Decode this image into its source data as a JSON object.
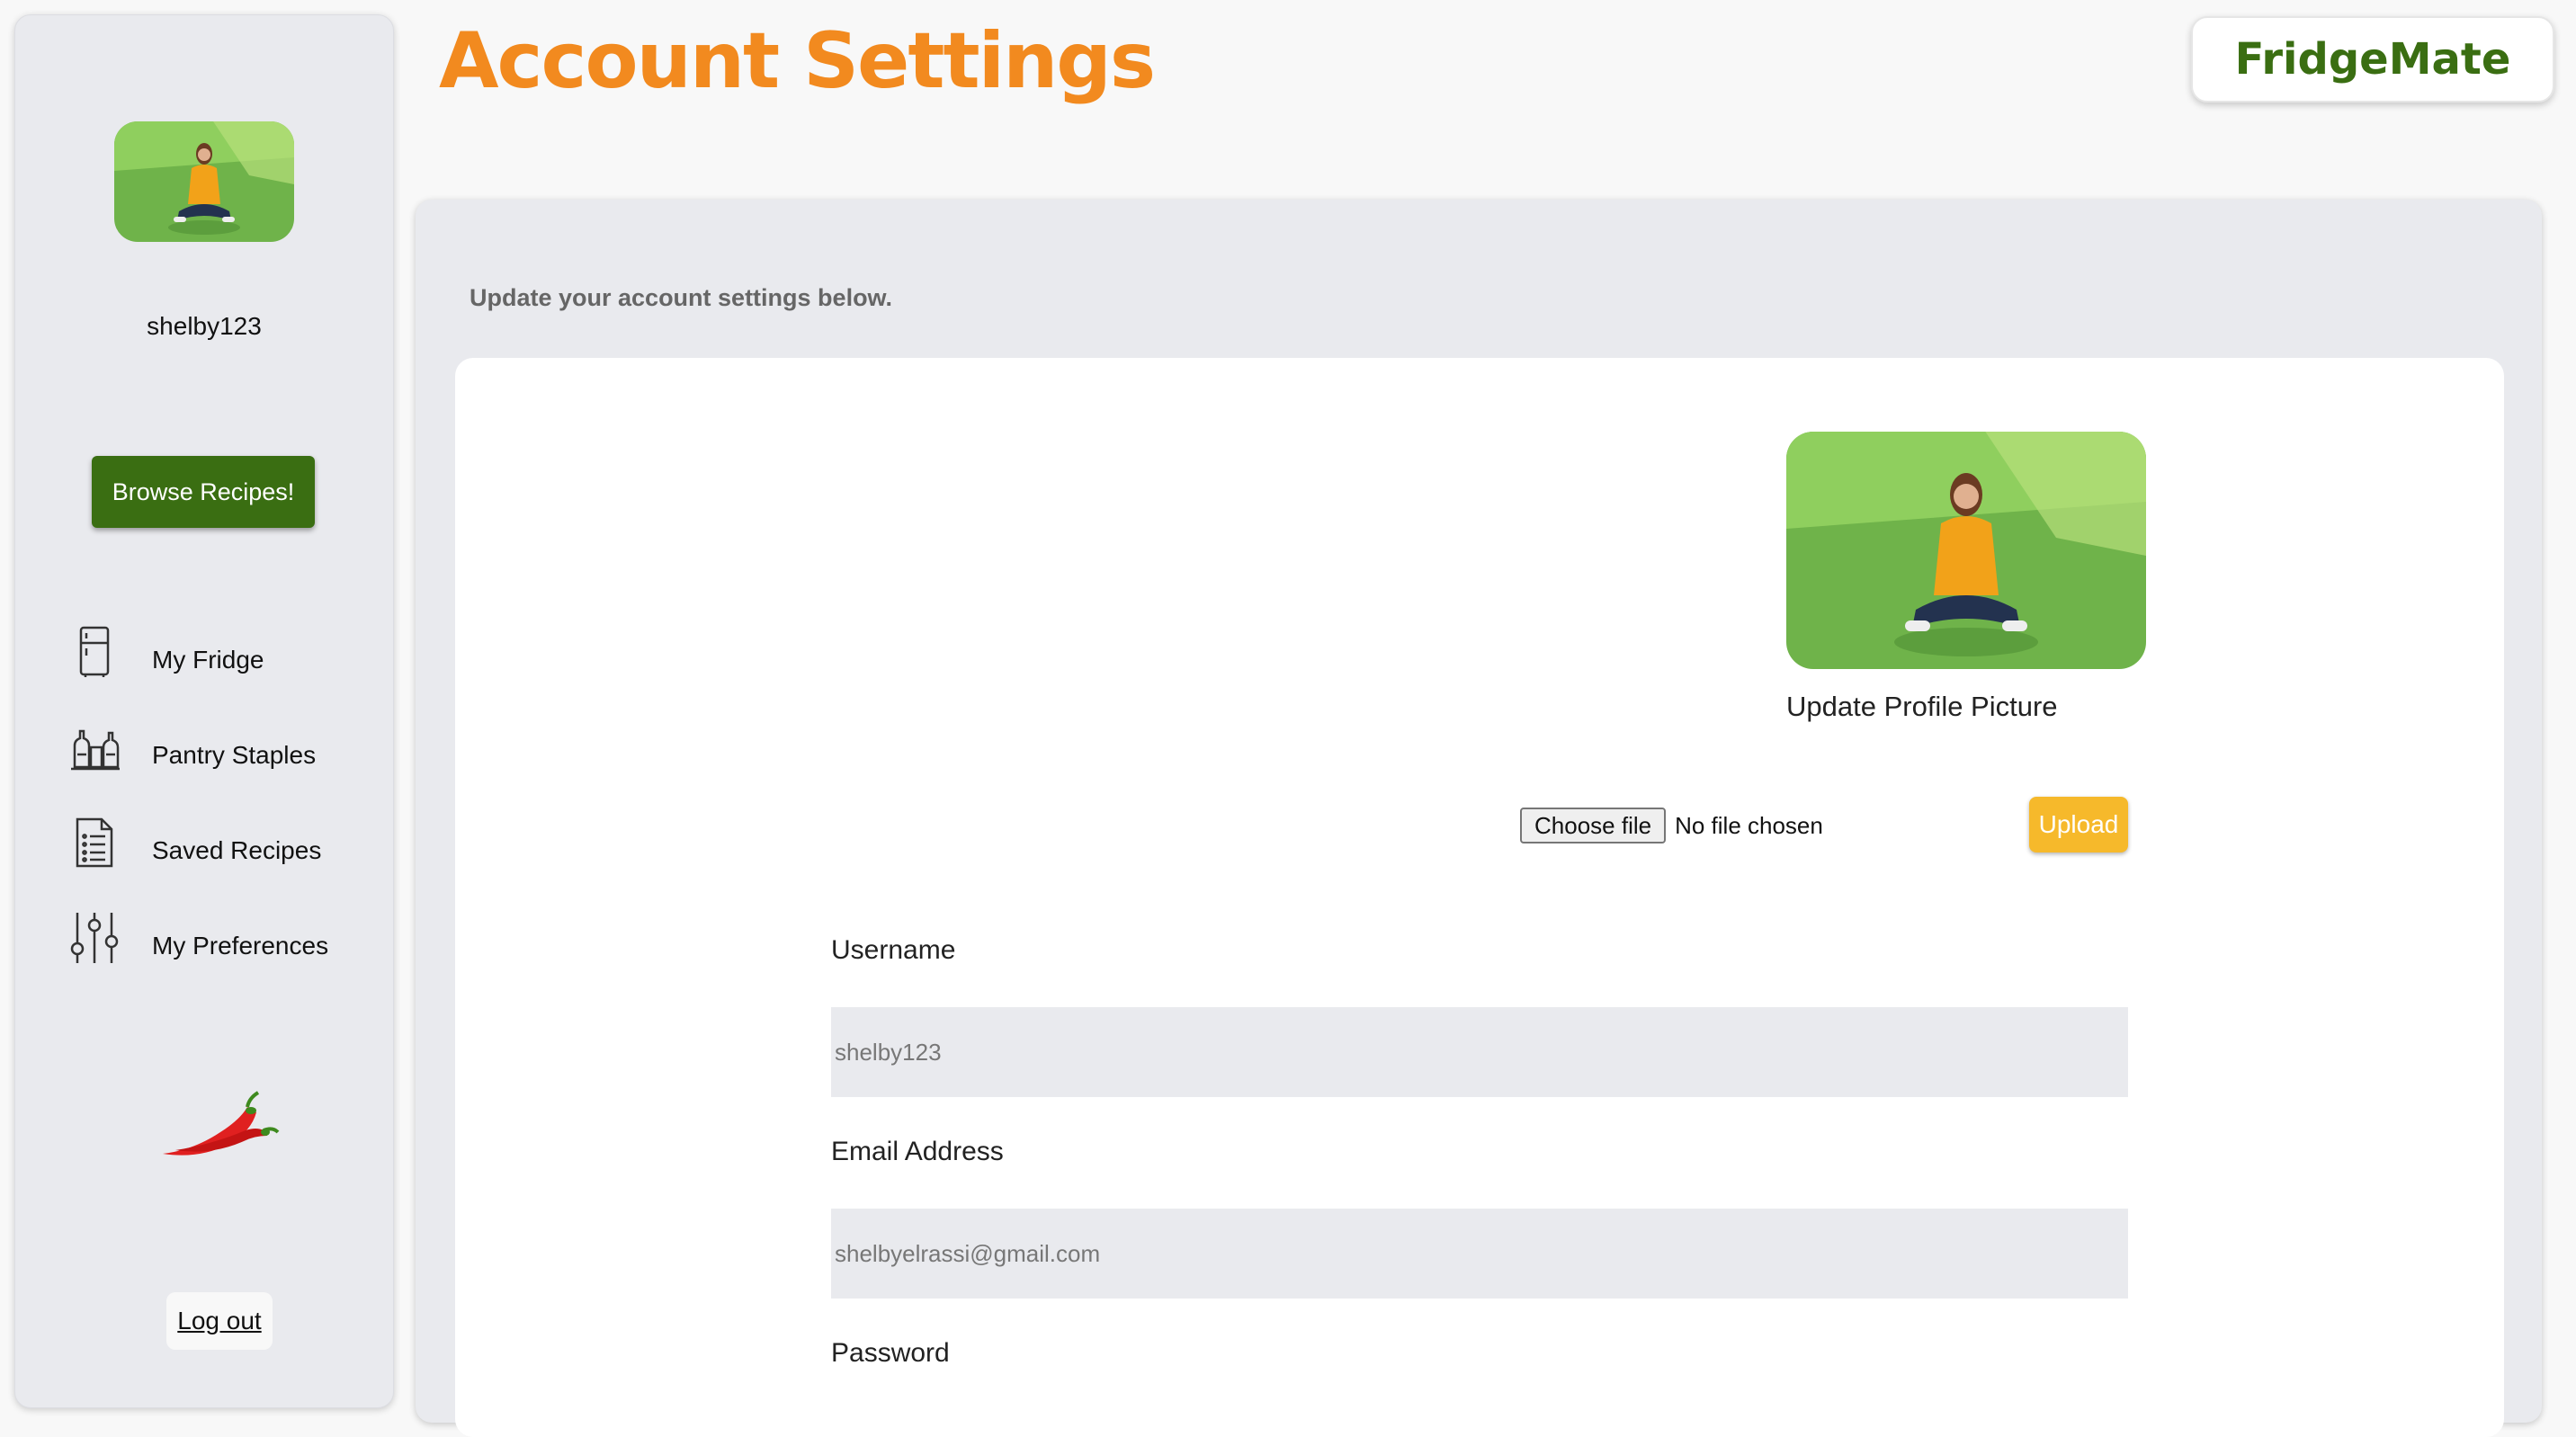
{
  "header": {
    "title": "Account Settings",
    "brand": "FridgeMate"
  },
  "sidebar": {
    "username": "shelby123",
    "browse_button": "Browse Recipes!",
    "items": [
      {
        "label": "My Fridge",
        "icon": "fridge-icon"
      },
      {
        "label": "Pantry Staples",
        "icon": "pantry-icon"
      },
      {
        "label": "Saved Recipes",
        "icon": "recipe-list-icon"
      },
      {
        "label": "My Preferences",
        "icon": "sliders-icon"
      }
    ],
    "logo_icon": "chili-pepper-icon",
    "logout": "Log out"
  },
  "main": {
    "subtitle": "Update your account settings below.",
    "update_picture_label": "Update Profile Picture",
    "file_input": {
      "button": "Choose file",
      "status": "No file chosen"
    },
    "upload_button": "Upload",
    "fields": {
      "username": {
        "label": "Username",
        "placeholder": "shelby123"
      },
      "email": {
        "label": "Email Address",
        "placeholder": "shelbyelrassi@gmail.com"
      },
      "password": {
        "label": "Password"
      }
    }
  },
  "colors": {
    "accent_orange": "#f28a1f",
    "brand_green": "#3a6e12",
    "upload_yellow": "#f6b92b",
    "panel_gray": "#e9eaee"
  }
}
